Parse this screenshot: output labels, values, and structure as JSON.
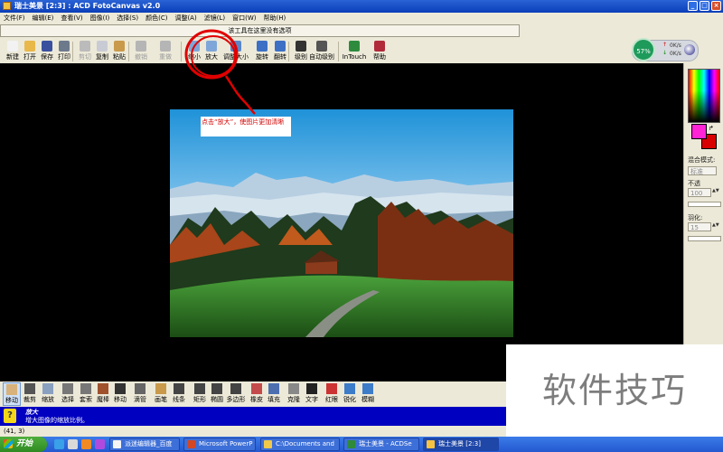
{
  "window": {
    "title": "瑞士美景 [2:3] : ACD FotoCanvas v2.0",
    "controls": [
      "_",
      "□",
      "×"
    ]
  },
  "menu": [
    "文件(F)",
    "编辑(E)",
    "查看(V)",
    "图像(I)",
    "选择(S)",
    "颜色(C)",
    "调整(A)",
    "滤镜(L)",
    "窗口(W)",
    "帮助(H)"
  ],
  "hint": "该工具在这里没有选项",
  "toolbar": {
    "buttons": [
      {
        "label": "新建",
        "color": "#f2f2f2",
        "disabled": false
      },
      {
        "label": "打开",
        "color": "#e8b84a",
        "disabled": false
      },
      {
        "label": "保存",
        "color": "#3a4f9e",
        "disabled": false
      },
      {
        "label": "打印",
        "color": "#6d7a8c",
        "disabled": false
      },
      {
        "label": "剪切",
        "color": "#bbbbbb",
        "disabled": true
      },
      {
        "label": "复制",
        "color": "#c9cbd4",
        "disabled": false
      },
      {
        "label": "粘贴",
        "color": "#c99a4b",
        "disabled": false
      },
      {
        "label": "撤销",
        "color": "#b5b5b5",
        "disabled": true
      },
      {
        "label": "重做",
        "color": "#b5b5b5",
        "disabled": true
      },
      {
        "label": "缩小",
        "color": "#7fa6d8",
        "disabled": false
      },
      {
        "label": "放大",
        "color": "#7fa6d8",
        "disabled": false
      },
      {
        "label": "调整大小",
        "color": "#5a86c7",
        "disabled": false
      },
      {
        "label": "旋转",
        "color": "#3d6fc4",
        "disabled": false
      },
      {
        "label": "翻转",
        "color": "#3d6fc4",
        "disabled": false
      },
      {
        "label": "级别",
        "color": "#333333",
        "disabled": false
      },
      {
        "label": "自动级别",
        "color": "#555555",
        "disabled": false
      },
      {
        "label": "InTouch",
        "color": "#2e8b3e",
        "disabled": false
      },
      {
        "label": "帮助",
        "color": "#b02a3a",
        "disabled": false
      }
    ]
  },
  "gauge": {
    "percent": "57%",
    "up": "0K/s",
    "down": "0K/s"
  },
  "callout": "点击“放大”，使图片更加清晰",
  "right_panel": {
    "blend_label": "混合模式:",
    "blend_value": "标准",
    "opacity_label": "不透",
    "opacity_value": "100",
    "feather_label": "羽化:",
    "feather_value": "15",
    "fg_color": "#ff24d6",
    "bg_color": "#d80000"
  },
  "tools": [
    {
      "label": "移动",
      "selected": true,
      "color": "#d8b27a"
    },
    {
      "label": "裁剪",
      "selected": false,
      "color": "#555555"
    },
    {
      "label": "缩放",
      "selected": false,
      "color": "#8aa0c0"
    },
    {
      "label": "选择",
      "selected": false,
      "color": "#777777"
    },
    {
      "label": "套索",
      "selected": false,
      "color": "#777777"
    },
    {
      "label": "魔棒",
      "selected": false,
      "color": "#a0522d"
    },
    {
      "label": "移动",
      "selected": false,
      "color": "#333333"
    },
    {
      "label": "滴管",
      "selected": false,
      "color": "#666666"
    },
    {
      "label": "画笔",
      "selected": false,
      "color": "#c99a4b"
    },
    {
      "label": "线条",
      "selected": false,
      "color": "#444444"
    },
    {
      "label": "矩形",
      "selected": false,
      "color": "#444444"
    },
    {
      "label": "椭圆",
      "selected": false,
      "color": "#444444"
    },
    {
      "label": "多边形",
      "selected": false,
      "color": "#444444"
    },
    {
      "label": "橡皮",
      "selected": false,
      "color": "#c44b4b"
    },
    {
      "label": "填充",
      "selected": false,
      "color": "#4d6fb0"
    },
    {
      "label": "克隆",
      "selected": false,
      "color": "#888888"
    },
    {
      "label": "文字",
      "selected": false,
      "color": "#222222"
    },
    {
      "label": "红眼",
      "selected": false,
      "color": "#cc3333"
    },
    {
      "label": "锐化",
      "selected": false,
      "color": "#3d7cc9"
    },
    {
      "label": "模糊",
      "selected": false,
      "color": "#3d7cc9"
    }
  ],
  "status": {
    "title": "放大",
    "desc": "增大图像的缩放比例。"
  },
  "coords": "(41, 3)",
  "watermark": "软件技巧",
  "taskbar": {
    "start": "开始",
    "tasks": [
      {
        "label": "派迷编辑器_百度",
        "color": "#f5f5f5",
        "active": false
      },
      {
        "label": "Microsoft PowerP",
        "color": "#d24726",
        "active": false
      },
      {
        "label": "C:\\Documents and",
        "color": "#f0c84a",
        "active": false
      },
      {
        "label": "瑞士美景 - ACDSe",
        "color": "#2f8a3a",
        "active": false
      },
      {
        "label": "瑞士美景 [2:3]",
        "color": "#f5c342",
        "active": true
      }
    ]
  }
}
